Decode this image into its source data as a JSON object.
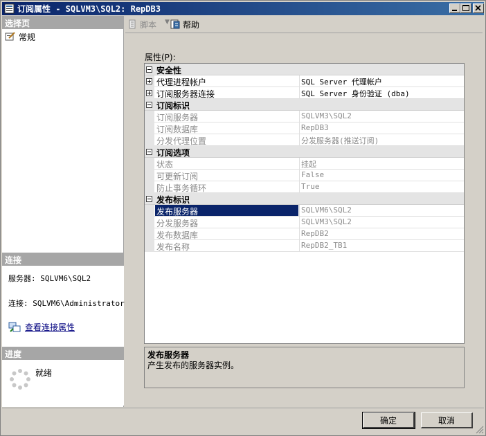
{
  "window": {
    "title": "订阅属性 - SQLVM3\\SQL2: RepDB3"
  },
  "left": {
    "pages_header": "选择页",
    "pages": [
      {
        "label": "常规"
      }
    ],
    "connection_header": "连接",
    "server_line": "服务器: SQLVM6\\SQL2",
    "connection_line": "连接: SQLVM6\\Administrator",
    "view_connection_link": "查看连接属性",
    "progress_header": "进度",
    "progress_status": "就绪"
  },
  "toolbar": {
    "script_label": "脚本",
    "help_label": "帮助"
  },
  "properties_label": "属性(P):",
  "grid": {
    "categories": [
      {
        "name": "安全性",
        "rows": [
          {
            "name": "代理进程帐户",
            "value": "SQL Server 代理帐户"
          },
          {
            "name": "订阅服务器连接",
            "value": "SQL Server 身份验证 (dba)"
          }
        ]
      },
      {
        "name": "订阅标识",
        "rows": [
          {
            "name": "订阅服务器",
            "value": "SQLVM3\\SQL2"
          },
          {
            "name": "订阅数据库",
            "value": "RepDB3"
          },
          {
            "name": "分发代理位置",
            "value": "分发服务器(推送订阅)"
          }
        ]
      },
      {
        "name": "订阅选项",
        "rows": [
          {
            "name": "状态",
            "value": "挂起"
          },
          {
            "name": "可更新订阅",
            "value": "False"
          },
          {
            "name": "防止事务循环",
            "value": "True"
          }
        ]
      },
      {
        "name": "发布标识",
        "rows": [
          {
            "name": "发布服务器",
            "value": "SQLVM6\\SQL2"
          },
          {
            "name": "分发服务器",
            "value": "SQLVM3\\SQL2"
          },
          {
            "name": "发布数据库",
            "value": "RepDB2"
          },
          {
            "name": "发布名称",
            "value": "RepDB2_TB1"
          }
        ]
      }
    ]
  },
  "description": {
    "title": "发布服务器",
    "text": "产生发布的服务器实例。"
  },
  "buttons": {
    "ok": "确定",
    "cancel": "取消"
  }
}
